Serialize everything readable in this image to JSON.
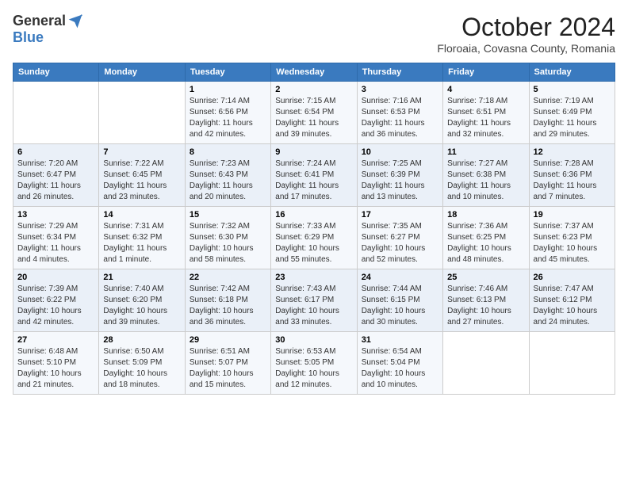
{
  "logo": {
    "general": "General",
    "blue": "Blue"
  },
  "header": {
    "month": "October 2024",
    "location": "Floroaia, Covasna County, Romania"
  },
  "days_of_week": [
    "Sunday",
    "Monday",
    "Tuesday",
    "Wednesday",
    "Thursday",
    "Friday",
    "Saturday"
  ],
  "weeks": [
    [
      {
        "day": "",
        "sunrise": "",
        "sunset": "",
        "daylight": ""
      },
      {
        "day": "",
        "sunrise": "",
        "sunset": "",
        "daylight": ""
      },
      {
        "day": "1",
        "sunrise": "Sunrise: 7:14 AM",
        "sunset": "Sunset: 6:56 PM",
        "daylight": "Daylight: 11 hours and 42 minutes."
      },
      {
        "day": "2",
        "sunrise": "Sunrise: 7:15 AM",
        "sunset": "Sunset: 6:54 PM",
        "daylight": "Daylight: 11 hours and 39 minutes."
      },
      {
        "day": "3",
        "sunrise": "Sunrise: 7:16 AM",
        "sunset": "Sunset: 6:53 PM",
        "daylight": "Daylight: 11 hours and 36 minutes."
      },
      {
        "day": "4",
        "sunrise": "Sunrise: 7:18 AM",
        "sunset": "Sunset: 6:51 PM",
        "daylight": "Daylight: 11 hours and 32 minutes."
      },
      {
        "day": "5",
        "sunrise": "Sunrise: 7:19 AM",
        "sunset": "Sunset: 6:49 PM",
        "daylight": "Daylight: 11 hours and 29 minutes."
      }
    ],
    [
      {
        "day": "6",
        "sunrise": "Sunrise: 7:20 AM",
        "sunset": "Sunset: 6:47 PM",
        "daylight": "Daylight: 11 hours and 26 minutes."
      },
      {
        "day": "7",
        "sunrise": "Sunrise: 7:22 AM",
        "sunset": "Sunset: 6:45 PM",
        "daylight": "Daylight: 11 hours and 23 minutes."
      },
      {
        "day": "8",
        "sunrise": "Sunrise: 7:23 AM",
        "sunset": "Sunset: 6:43 PM",
        "daylight": "Daylight: 11 hours and 20 minutes."
      },
      {
        "day": "9",
        "sunrise": "Sunrise: 7:24 AM",
        "sunset": "Sunset: 6:41 PM",
        "daylight": "Daylight: 11 hours and 17 minutes."
      },
      {
        "day": "10",
        "sunrise": "Sunrise: 7:25 AM",
        "sunset": "Sunset: 6:39 PM",
        "daylight": "Daylight: 11 hours and 13 minutes."
      },
      {
        "day": "11",
        "sunrise": "Sunrise: 7:27 AM",
        "sunset": "Sunset: 6:38 PM",
        "daylight": "Daylight: 11 hours and 10 minutes."
      },
      {
        "day": "12",
        "sunrise": "Sunrise: 7:28 AM",
        "sunset": "Sunset: 6:36 PM",
        "daylight": "Daylight: 11 hours and 7 minutes."
      }
    ],
    [
      {
        "day": "13",
        "sunrise": "Sunrise: 7:29 AM",
        "sunset": "Sunset: 6:34 PM",
        "daylight": "Daylight: 11 hours and 4 minutes."
      },
      {
        "day": "14",
        "sunrise": "Sunrise: 7:31 AM",
        "sunset": "Sunset: 6:32 PM",
        "daylight": "Daylight: 11 hours and 1 minute."
      },
      {
        "day": "15",
        "sunrise": "Sunrise: 7:32 AM",
        "sunset": "Sunset: 6:30 PM",
        "daylight": "Daylight: 10 hours and 58 minutes."
      },
      {
        "day": "16",
        "sunrise": "Sunrise: 7:33 AM",
        "sunset": "Sunset: 6:29 PM",
        "daylight": "Daylight: 10 hours and 55 minutes."
      },
      {
        "day": "17",
        "sunrise": "Sunrise: 7:35 AM",
        "sunset": "Sunset: 6:27 PM",
        "daylight": "Daylight: 10 hours and 52 minutes."
      },
      {
        "day": "18",
        "sunrise": "Sunrise: 7:36 AM",
        "sunset": "Sunset: 6:25 PM",
        "daylight": "Daylight: 10 hours and 48 minutes."
      },
      {
        "day": "19",
        "sunrise": "Sunrise: 7:37 AM",
        "sunset": "Sunset: 6:23 PM",
        "daylight": "Daylight: 10 hours and 45 minutes."
      }
    ],
    [
      {
        "day": "20",
        "sunrise": "Sunrise: 7:39 AM",
        "sunset": "Sunset: 6:22 PM",
        "daylight": "Daylight: 10 hours and 42 minutes."
      },
      {
        "day": "21",
        "sunrise": "Sunrise: 7:40 AM",
        "sunset": "Sunset: 6:20 PM",
        "daylight": "Daylight: 10 hours and 39 minutes."
      },
      {
        "day": "22",
        "sunrise": "Sunrise: 7:42 AM",
        "sunset": "Sunset: 6:18 PM",
        "daylight": "Daylight: 10 hours and 36 minutes."
      },
      {
        "day": "23",
        "sunrise": "Sunrise: 7:43 AM",
        "sunset": "Sunset: 6:17 PM",
        "daylight": "Daylight: 10 hours and 33 minutes."
      },
      {
        "day": "24",
        "sunrise": "Sunrise: 7:44 AM",
        "sunset": "Sunset: 6:15 PM",
        "daylight": "Daylight: 10 hours and 30 minutes."
      },
      {
        "day": "25",
        "sunrise": "Sunrise: 7:46 AM",
        "sunset": "Sunset: 6:13 PM",
        "daylight": "Daylight: 10 hours and 27 minutes."
      },
      {
        "day": "26",
        "sunrise": "Sunrise: 7:47 AM",
        "sunset": "Sunset: 6:12 PM",
        "daylight": "Daylight: 10 hours and 24 minutes."
      }
    ],
    [
      {
        "day": "27",
        "sunrise": "Sunrise: 6:48 AM",
        "sunset": "Sunset: 5:10 PM",
        "daylight": "Daylight: 10 hours and 21 minutes."
      },
      {
        "day": "28",
        "sunrise": "Sunrise: 6:50 AM",
        "sunset": "Sunset: 5:09 PM",
        "daylight": "Daylight: 10 hours and 18 minutes."
      },
      {
        "day": "29",
        "sunrise": "Sunrise: 6:51 AM",
        "sunset": "Sunset: 5:07 PM",
        "daylight": "Daylight: 10 hours and 15 minutes."
      },
      {
        "day": "30",
        "sunrise": "Sunrise: 6:53 AM",
        "sunset": "Sunset: 5:05 PM",
        "daylight": "Daylight: 10 hours and 12 minutes."
      },
      {
        "day": "31",
        "sunrise": "Sunrise: 6:54 AM",
        "sunset": "Sunset: 5:04 PM",
        "daylight": "Daylight: 10 hours and 10 minutes."
      },
      {
        "day": "",
        "sunrise": "",
        "sunset": "",
        "daylight": ""
      },
      {
        "day": "",
        "sunrise": "",
        "sunset": "",
        "daylight": ""
      }
    ]
  ]
}
